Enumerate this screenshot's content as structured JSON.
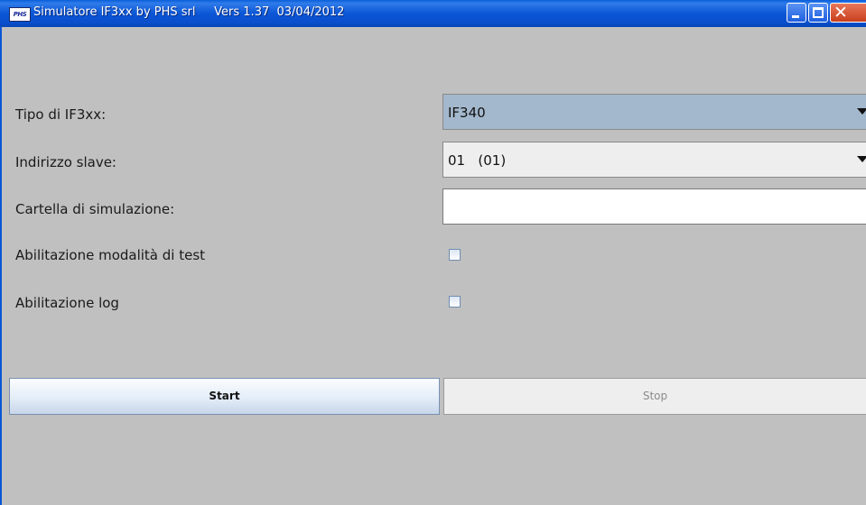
{
  "window": {
    "icon_text": "PHS",
    "title": "Simulatore IF3xx by PHS srl     Vers 1.37  03/04/2012"
  },
  "form": {
    "tipo_label": "Tipo di IF3xx:",
    "tipo_value": "IF340",
    "indirizzo_label": "Indirizzo slave:",
    "indirizzo_value": "01   (01)",
    "cartella_label": "Cartella di simulazione:",
    "cartella_value": "",
    "test_label": "Abilitazione modalità di test",
    "test_checked": false,
    "log_label": "Abilitazione log",
    "log_checked": false
  },
  "buttons": {
    "start": "Start",
    "stop": "Stop"
  }
}
